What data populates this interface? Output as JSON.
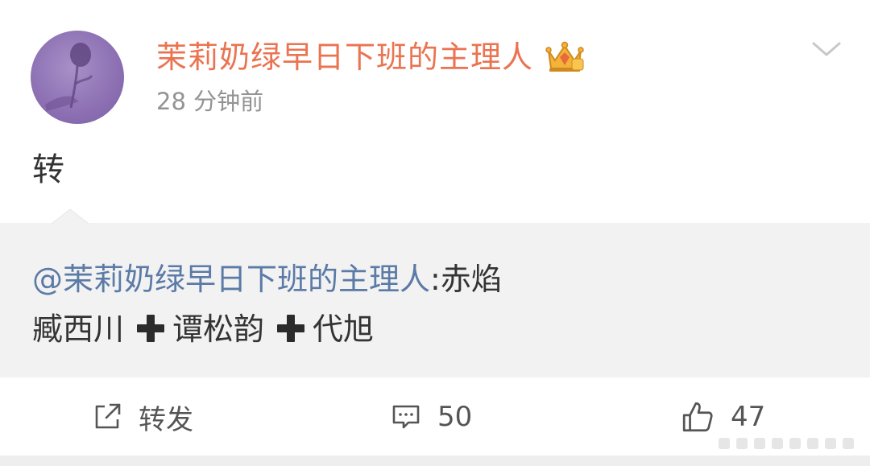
{
  "post": {
    "author": "茉莉奶绿早日下班的主理人",
    "timestamp": "28 分钟前",
    "text": "转"
  },
  "repost": {
    "mention": "@茉莉奶绿早日下班的主理人",
    "line1_rest": ":赤焰",
    "line2_a": "臧西川",
    "line2_b": "谭松韵",
    "line2_c": "代旭"
  },
  "actions": {
    "repost_label": "转发",
    "comment_count": "50",
    "like_count": "47"
  },
  "colors": {
    "username": "#eb7350",
    "mention": "#5b7aa6",
    "repost_bg": "#f2f2f2",
    "timestamp": "#939393"
  },
  "icons": [
    "avatar-rose-image",
    "vip-crown-icon",
    "chevron-down-icon",
    "plus-icon",
    "share-icon",
    "comment-icon",
    "like-icon"
  ]
}
